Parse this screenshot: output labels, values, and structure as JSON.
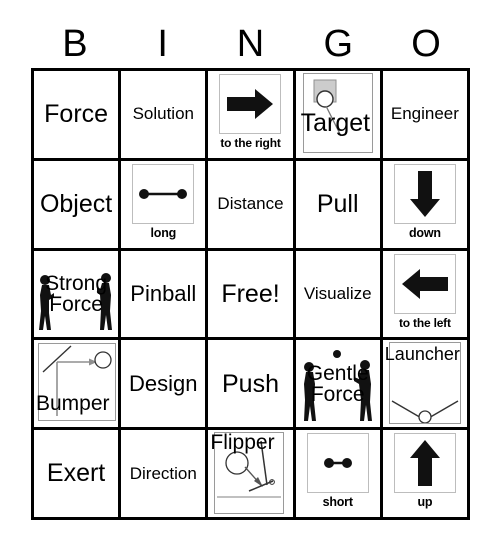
{
  "card": {
    "title": "BINGO",
    "header_letters": [
      "B",
      "I",
      "N",
      "G",
      "O"
    ],
    "free_space_label": "Free!",
    "colors": {
      "ink": "#000000",
      "paper": "#ffffff",
      "image_border": "#bdbdbd",
      "diagram_gray": "#9a9a9a",
      "target_square_fill": "#cccccc"
    }
  },
  "rows": [
    [
      {
        "id": "b1",
        "kind": "word",
        "label": "Force",
        "size": "xl"
      },
      {
        "id": "i1",
        "kind": "word",
        "label": "Solution",
        "size": "md"
      },
      {
        "id": "n1",
        "kind": "picture",
        "label": "to the right",
        "icon": "arrow-right-icon"
      },
      {
        "id": "g1",
        "kind": "overlay",
        "label": "Target",
        "icon": "target-diagram-icon"
      },
      {
        "id": "o1",
        "kind": "word",
        "label": "Engineer",
        "size": "md"
      }
    ],
    [
      {
        "id": "b2",
        "kind": "word",
        "label": "Object",
        "size": "xl"
      },
      {
        "id": "i2",
        "kind": "picture",
        "label": "long",
        "icon": "long-segment-icon"
      },
      {
        "id": "n2",
        "kind": "word",
        "label": "Distance",
        "size": "md"
      },
      {
        "id": "g2",
        "kind": "word",
        "label": "Pull",
        "size": "xl"
      },
      {
        "id": "o2",
        "kind": "picture",
        "label": "down",
        "icon": "arrow-down-icon"
      }
    ],
    [
      {
        "id": "b3",
        "kind": "force",
        "label": "Strong Force",
        "line1": "Strong",
        "line2": "Force"
      },
      {
        "id": "i3",
        "kind": "word",
        "label": "Pinball",
        "size": "lg"
      },
      {
        "id": "n3",
        "kind": "word",
        "label": "Free!",
        "size": "xl"
      },
      {
        "id": "g3",
        "kind": "word",
        "label": "Visualize",
        "size": "md"
      },
      {
        "id": "o3",
        "kind": "picture",
        "label": "to the left",
        "icon": "arrow-left-icon"
      }
    ],
    [
      {
        "id": "b4",
        "kind": "overlay",
        "label": "Bumper",
        "icon": "bumper-diagram-icon"
      },
      {
        "id": "i4",
        "kind": "word",
        "label": "Design",
        "size": "lg"
      },
      {
        "id": "n4",
        "kind": "word",
        "label": "Push",
        "size": "xl"
      },
      {
        "id": "g4",
        "kind": "force",
        "label": "Gentle Force",
        "line1": "Gentle",
        "line2": "Force"
      },
      {
        "id": "o4",
        "kind": "overlay",
        "label": "Launcher",
        "icon": "launcher-diagram-icon"
      }
    ],
    [
      {
        "id": "b5",
        "kind": "word",
        "label": "Exert",
        "size": "xl"
      },
      {
        "id": "i5",
        "kind": "word",
        "label": "Direction",
        "size": "md"
      },
      {
        "id": "n5",
        "kind": "overlay",
        "label": "Flipper",
        "icon": "flipper-diagram-icon"
      },
      {
        "id": "g5",
        "kind": "picture",
        "label": "short",
        "icon": "short-segment-icon"
      },
      {
        "id": "o5",
        "kind": "picture",
        "label": "up",
        "icon": "arrow-up-icon"
      }
    ]
  ]
}
